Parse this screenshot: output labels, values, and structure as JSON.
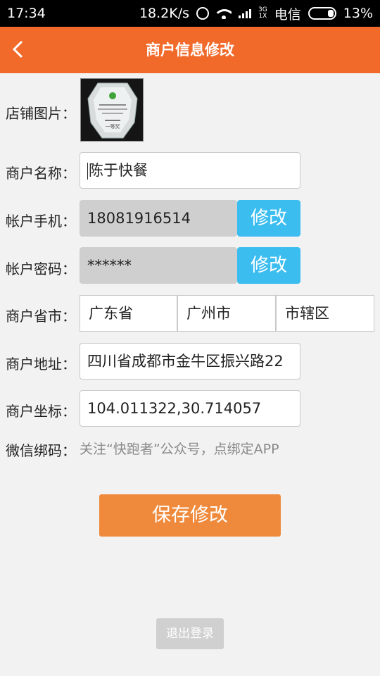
{
  "status_bar": {
    "time": "17:34",
    "speed": "18.2K/s",
    "net_top": "3G",
    "net_bottom": "1X",
    "carrier": "电信",
    "battery": "13%"
  },
  "header": {
    "title": "商户信息修改",
    "back_icon": "chevron-left-icon"
  },
  "form": {
    "store_image": {
      "label": "店铺图片：",
      "trophy_top": "一等奖"
    },
    "name": {
      "label": "商户名称：",
      "value": "陈于快餐"
    },
    "phone": {
      "label": "帐户手机：",
      "value": "18081916514",
      "button": "修改"
    },
    "password": {
      "label": "帐户密码：",
      "value": "******",
      "button": "修改"
    },
    "province_city": {
      "label": "商户省市：",
      "province": "广东省",
      "city": "广州市",
      "district": "市辖区"
    },
    "address": {
      "label": "商户地址：",
      "value": "四川省成都市金牛区振兴路22"
    },
    "coordinates": {
      "label": "商户坐标：",
      "value": "104.011322,30.714057"
    },
    "wechat": {
      "label": "微信绑码：",
      "hint": "关注“快跑者”公众号，点绑定APP"
    }
  },
  "actions": {
    "save": "保存修改",
    "logout": "退出登录"
  },
  "colors": {
    "header": "#f26a2a",
    "modify_button": "#3bbdf0",
    "save_button": "#ef8a3c"
  }
}
